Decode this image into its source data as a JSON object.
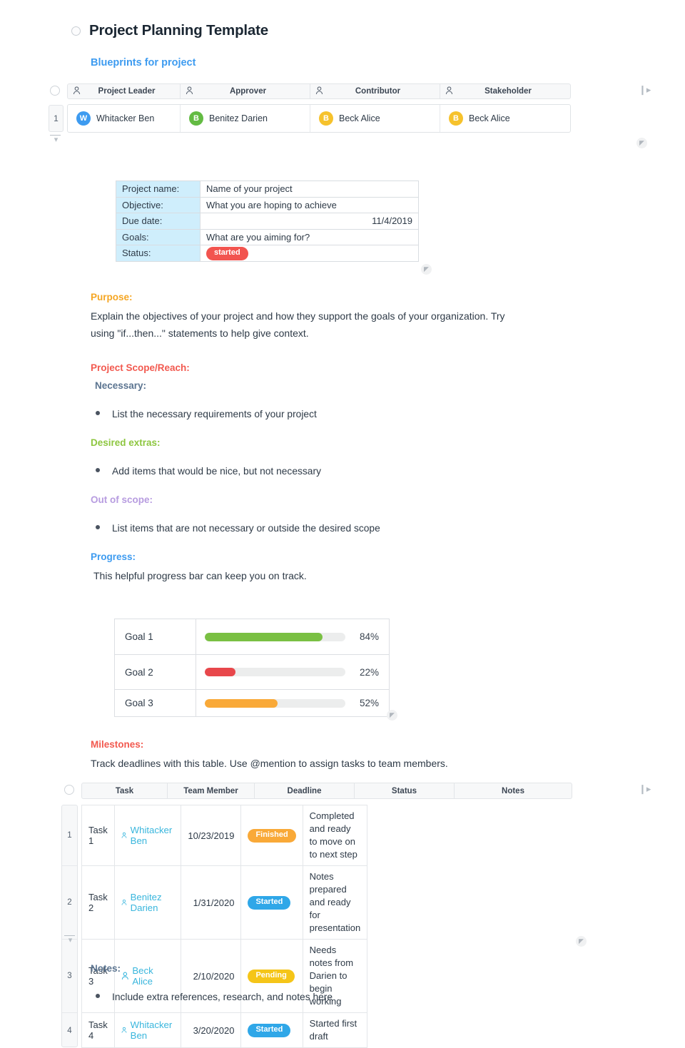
{
  "document": {
    "title": "Project Planning Template",
    "subtitle": "Blueprints for project"
  },
  "people_table": {
    "row_number": "1",
    "columns": [
      {
        "label": "Project Leader",
        "icon": "person-icon"
      },
      {
        "label": "Approver",
        "icon": "person-icon"
      },
      {
        "label": "Contributor",
        "icon": "person-icon"
      },
      {
        "label": "Stakeholder",
        "icon": "person-icon"
      }
    ],
    "people": [
      {
        "initial": "W",
        "name": "Whitacker Ben",
        "color": "#3d9bf0"
      },
      {
        "initial": "B",
        "name": "Benitez Darien",
        "color": "#63bb43"
      },
      {
        "initial": "B",
        "name": "Beck Alice",
        "color": "#f6c22c"
      },
      {
        "initial": "B",
        "name": "Beck Alice",
        "color": "#f6c22c"
      }
    ]
  },
  "info_table": {
    "rows": [
      {
        "label": "Project name:",
        "value": "Name of your project",
        "align": "left"
      },
      {
        "label": "Objective:",
        "value": "What you are hoping to achieve",
        "align": "left"
      },
      {
        "label": "Due date:",
        "value": "11/4/2019",
        "align": "right"
      },
      {
        "label": "Goals:",
        "value": "What are you aiming for?",
        "align": "left"
      }
    ],
    "status_label": "Status:",
    "status_value": "started",
    "status_color": "#f2544f",
    "label_bg": "#cfeefc"
  },
  "sections": {
    "purpose": {
      "heading": "Purpose:",
      "color": "#f5a623",
      "body_line1": "Explain the objectives of your project and how they support the goals of your organization. Try",
      "body_line2": "using \"if...then...\" statements to help give context."
    },
    "scope": {
      "heading": "Project Scope/Reach:",
      "color": "#f2594f"
    },
    "necessary": {
      "heading": "Necessary:",
      "color": "#5b7490",
      "bullet": "List the necessary requirements of your project"
    },
    "desired": {
      "heading": "Desired extras:",
      "color": "#8dc63f",
      "bullet": "Add items that would be nice, but not necessary"
    },
    "out_of_scope": {
      "heading": "Out of scope:",
      "color": "#b79ce0",
      "bullet": "List items that are not necessary or outside the desired scope"
    },
    "progress": {
      "heading": "Progress:",
      "color": "#3d9bf0",
      "body": "This helpful progress bar can keep you on track."
    },
    "milestones": {
      "heading": "Milestones:",
      "color": "#f2594f",
      "body": "Track deadlines with this table. Use @mention to assign tasks to team members."
    },
    "notes": {
      "heading": "Notes:",
      "color": "#5b7490",
      "bullet": "Include extra references, research, and notes here"
    }
  },
  "chart_data": {
    "type": "bar",
    "title": "Progress",
    "categories": [
      "Goal 1",
      "Goal 2",
      "Goal 3"
    ],
    "values": [
      84,
      22,
      52
    ],
    "value_labels": [
      "84%",
      "22%",
      "52%"
    ],
    "colors": [
      "#7ac043",
      "#e8474b",
      "#f9a938"
    ],
    "track_color": "#eceded",
    "xlabel": "",
    "ylabel": "",
    "xlim": [
      0,
      100
    ],
    "grid": false,
    "legend": "none",
    "orientation": "horizontal"
  },
  "milestones_table": {
    "columns": [
      "Task",
      "Team Member",
      "Deadline",
      "Status",
      "Notes"
    ],
    "rows": [
      {
        "num": "1",
        "task": "Task 1",
        "member": "Whitacker Ben",
        "deadline": "10/23/2019",
        "status": "Finished",
        "status_color": "#f9a938",
        "notes": "Completed and ready to move on to next step"
      },
      {
        "num": "2",
        "task": "Task 2",
        "member": "Benitez Darien",
        "deadline": "1/31/2020",
        "status": "Started",
        "status_color": "#2fa7e8",
        "notes": "Notes prepared and ready for presentation"
      },
      {
        "num": "3",
        "task": "Task 3",
        "member": "Beck Alice",
        "deadline": "2/10/2020",
        "status": "Pending",
        "status_color": "#f5c518",
        "notes": "Needs notes from Darien to begin working"
      },
      {
        "num": "4",
        "task": "Task 4",
        "member": "Whitacker Ben",
        "deadline": "3/20/2020",
        "status": "Started",
        "status_color": "#2fa7e8",
        "notes": "Started first draft"
      }
    ]
  }
}
